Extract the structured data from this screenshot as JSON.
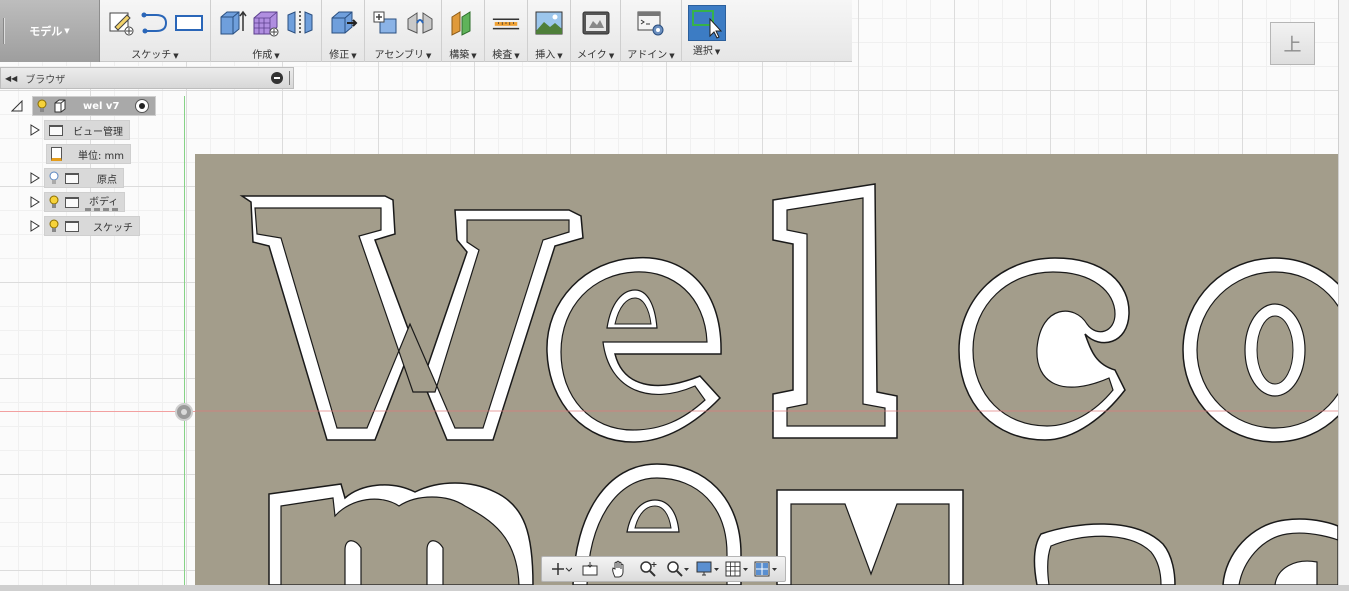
{
  "toolbar": {
    "workspace": "モデル",
    "groups": [
      {
        "id": "sketch",
        "label": "スケッチ"
      },
      {
        "id": "create",
        "label": "作成"
      },
      {
        "id": "modify",
        "label": "修正"
      },
      {
        "id": "assemble",
        "label": "アセンブリ"
      },
      {
        "id": "construct",
        "label": "構築"
      },
      {
        "id": "inspect",
        "label": "検査"
      },
      {
        "id": "insert",
        "label": "挿入"
      },
      {
        "id": "make",
        "label": "メイク"
      },
      {
        "id": "addins",
        "label": "アドイン"
      },
      {
        "id": "select",
        "label": "選択"
      }
    ]
  },
  "browser": {
    "title": "ブラウザ",
    "root": "wel v7",
    "items": [
      {
        "label": "ビュー管理"
      },
      {
        "label": "単位: mm"
      },
      {
        "label": "原点"
      },
      {
        "label": "ボディ"
      },
      {
        "label": "スケッチ"
      }
    ]
  },
  "viewcube": {
    "face": "上"
  },
  "colors": {
    "accent": "#3c7cc4",
    "canvas_surface": "#a39d8b",
    "text_outline": "#ffffff"
  }
}
